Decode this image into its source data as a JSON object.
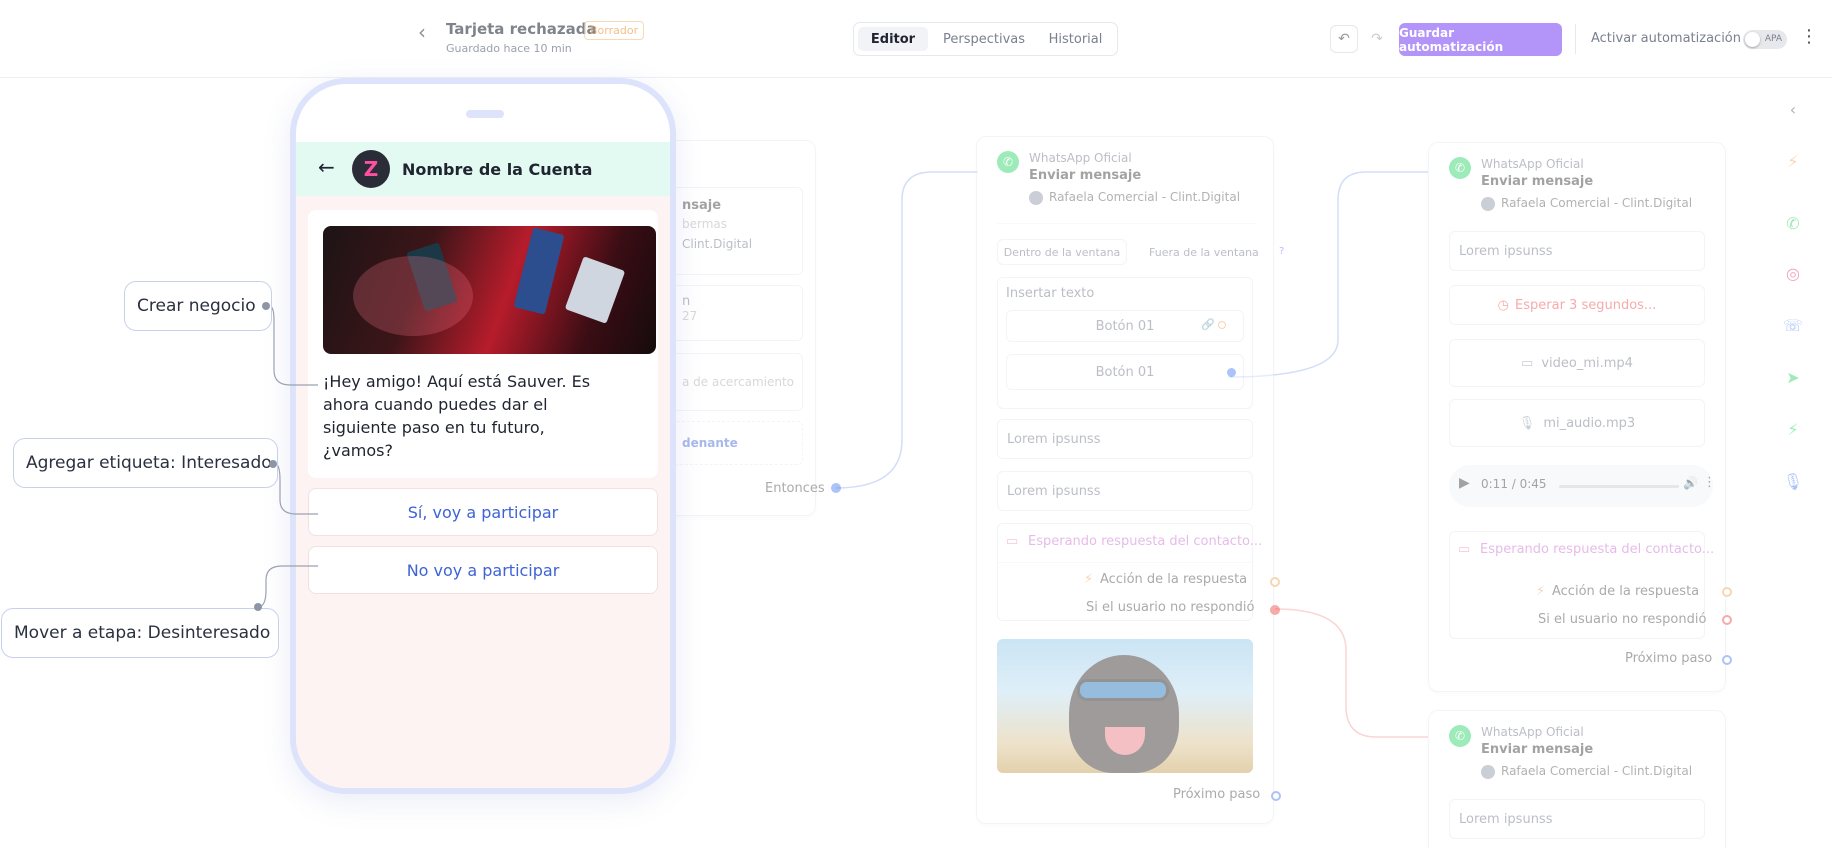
{
  "header": {
    "back_icon": "chevron-left-icon",
    "title": "Tarjeta rechazada",
    "status_badge": "Borrador",
    "saved_text": "Guardado hace 10 min",
    "tabs": [
      {
        "label": "Editor",
        "active": true
      },
      {
        "label": "Perspectivas",
        "active": false
      },
      {
        "label": "Historial",
        "active": false
      }
    ],
    "undo_icon": "undo-icon",
    "redo_icon": "redo-icon",
    "save_label": "Guardar automatización",
    "activate_label": "Activar automatización",
    "toggle_label": "APA",
    "menu_icon": "more-vertical-icon",
    "accent_color": "#8b5cf6"
  },
  "partial_card": {
    "line1": "nsaje",
    "line2": "bermas",
    "line3": "Clint.Digital",
    "line4": "n",
    "line5": "27",
    "line6": "a de acercamiento",
    "line7": "denante",
    "then_label": "Entonces"
  },
  "card_center": {
    "channel": "WhatsApp Oficial",
    "action": "Enviar mensaje",
    "account": "Rafaela Comercial - Clint.Digital",
    "tab_inside": "Dentro de la ventana",
    "tab_outside": "Fuera de la ventana",
    "help": "?",
    "insert_text": "Insertar texto",
    "button1": "Botón 01",
    "button2": "Botón 01",
    "lorem1": "Lorem ipsunss",
    "lorem2": "Lorem ipsunss",
    "waiting": "Esperando respuesta del contacto...",
    "response_action": "Acción de la respuesta",
    "no_response": "Si el usuario no respondió",
    "next_step": "Próximo paso"
  },
  "card_right_top": {
    "channel": "WhatsApp Oficial",
    "action": "Enviar mensaje",
    "account": "Rafaela Comercial - Clint.Digital",
    "lorem": "Lorem ipsunss",
    "wait": "Esperar 3 segundos...",
    "video": "video_mi.mp4",
    "audio": "mi_audio.mp3",
    "player_time": "0:11 / 0:45",
    "waiting": "Esperando respuesta del contacto...",
    "response_action": "Acción de la respuesta",
    "no_response": "Si el usuario no respondió",
    "next_step": "Próximo paso"
  },
  "card_right_bottom": {
    "channel": "WhatsApp Oficial",
    "action": "Enviar mensaje",
    "account": "Rafaela Comercial - Clint.Digital",
    "lorem": "Lorem ipsunss"
  },
  "phone": {
    "account_name": "Nombre de la Cuenta",
    "back_icon": "arrow-left-icon",
    "message": "¡Hey amigo! Aquí está Sauver. Es ahora cuando puedes dar el siguiente paso en tu futuro, ¿vamos?",
    "reply1": "Sí, voy a participar",
    "reply2": "No voy a participar"
  },
  "annotations": {
    "create_deal": "Crear negocio",
    "add_tag": "Agregar etiqueta: Interesado",
    "move_stage": "Mover a etapa: Desinteresado"
  },
  "rail_icons": [
    "chevron-left-icon",
    "lightning-icon",
    "whatsapp-icon",
    "instagram-icon",
    "phone-icon",
    "send-icon",
    "lightning-green-icon",
    "microphone-icon"
  ]
}
